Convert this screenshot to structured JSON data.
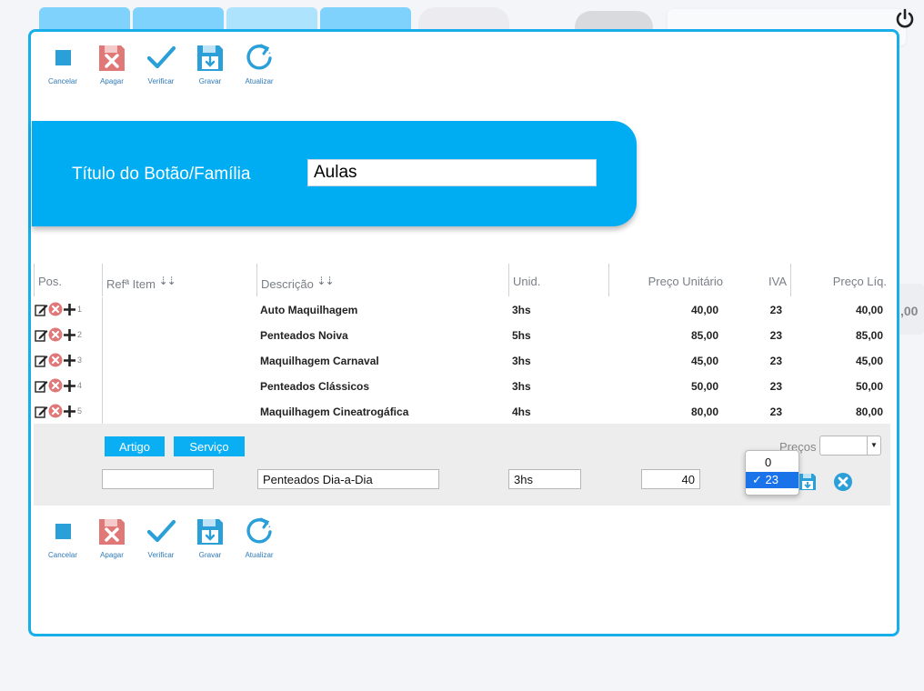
{
  "toolbar": {
    "cancel_label": "Cancelar",
    "delete_label": "Apagar",
    "verify_label": "Verificar",
    "save_label": "Gravar",
    "refresh_label": "Atualizar"
  },
  "form": {
    "title_label": "Título do Botão/Família",
    "title_value": "Aulas"
  },
  "table": {
    "headers": {
      "pos": "Pos.",
      "ref": "Refª Item",
      "desc": "Descrição",
      "unid": "Unid.",
      "price": "Preço Unitário",
      "iva": "IVA",
      "net": "Preço Líq."
    },
    "sort_glyphs": "⇣⇣",
    "rows": [
      {
        "pos": "1",
        "ref": "",
        "desc": "Auto Maquilhagem",
        "unid": "3hs",
        "price": "40,00",
        "iva": "23",
        "net": "40,00"
      },
      {
        "pos": "2",
        "ref": "",
        "desc": "Penteados Noiva",
        "unid": "5hs",
        "price": "85,00",
        "iva": "23",
        "net": "85,00"
      },
      {
        "pos": "3",
        "ref": "",
        "desc": "Maquilhagem Carnaval",
        "unid": "3hs",
        "price": "45,00",
        "iva": "23",
        "net": "45,00"
      },
      {
        "pos": "4",
        "ref": "",
        "desc": "Penteados Clássicos",
        "unid": "3hs",
        "price": "50,00",
        "iva": "23",
        "net": "50,00"
      },
      {
        "pos": "5",
        "ref": "",
        "desc": "Maquilhagem Cineatrogáfica",
        "unid": "4hs",
        "price": "80,00",
        "iva": "23",
        "net": "80,00"
      }
    ]
  },
  "edit": {
    "artigo_label": "Artigo",
    "servico_label": "Serviço",
    "precos_label": "Preços",
    "ref_value": "",
    "desc_value": "Penteados Dia-a-Dia",
    "unid_value": "3hs",
    "price_value": "40",
    "iva_options": [
      "0",
      "✓ 23"
    ]
  },
  "background": {
    "side_value": ",00"
  },
  "colors": {
    "accent": "#00adf3",
    "border": "#17aee9",
    "delete_red": "#e07878",
    "icon_blue": "#2a9fd8"
  }
}
